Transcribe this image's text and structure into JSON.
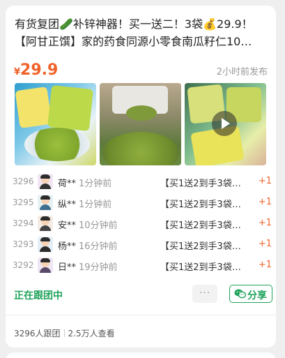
{
  "post": {
    "title_line1": "有货复团🥒补锌神器！买一送二！3袋💰29.9！",
    "title_line2": "【阿甘正馔】家的药食同源小零食南瓜籽仁10…",
    "price_symbol": "¥",
    "price": "29.9",
    "published": "2小时前发布"
  },
  "images": [
    {
      "icon": "product-bag-and-seeds-photo"
    },
    {
      "icon": "hand-holding-seeds-photo"
    },
    {
      "icon": "video-thumbnail-photo",
      "has_play": true
    }
  ],
  "records": [
    {
      "no": "3296",
      "user": "荷**",
      "time": "1分钟前",
      "item": "【买1送2到手3袋…",
      "qty": "+1"
    },
    {
      "no": "3295",
      "user": "纵**",
      "time": "1分钟前",
      "item": "【买1送2到手3袋…",
      "qty": "+1"
    },
    {
      "no": "3294",
      "user": "安**",
      "time": "10分钟前",
      "item": "【买1送2到手3袋…",
      "qty": "+1"
    },
    {
      "no": "3293",
      "user": "杨**",
      "time": "16分钟前",
      "item": "【买1送2到手3袋…",
      "qty": "+1"
    },
    {
      "no": "3292",
      "user": "日**",
      "time": "19分钟前",
      "item": "【买1送2到手3袋…",
      "qty": "+1"
    }
  ],
  "actions": {
    "following": "正在跟团中",
    "more": "···",
    "share": "分享"
  },
  "stats": {
    "joined": "3296人跟团",
    "views": "2.5万人查看"
  },
  "colors": {
    "price": "#f0622a",
    "accent_green": "#1fa35a",
    "muted": "#999999"
  }
}
